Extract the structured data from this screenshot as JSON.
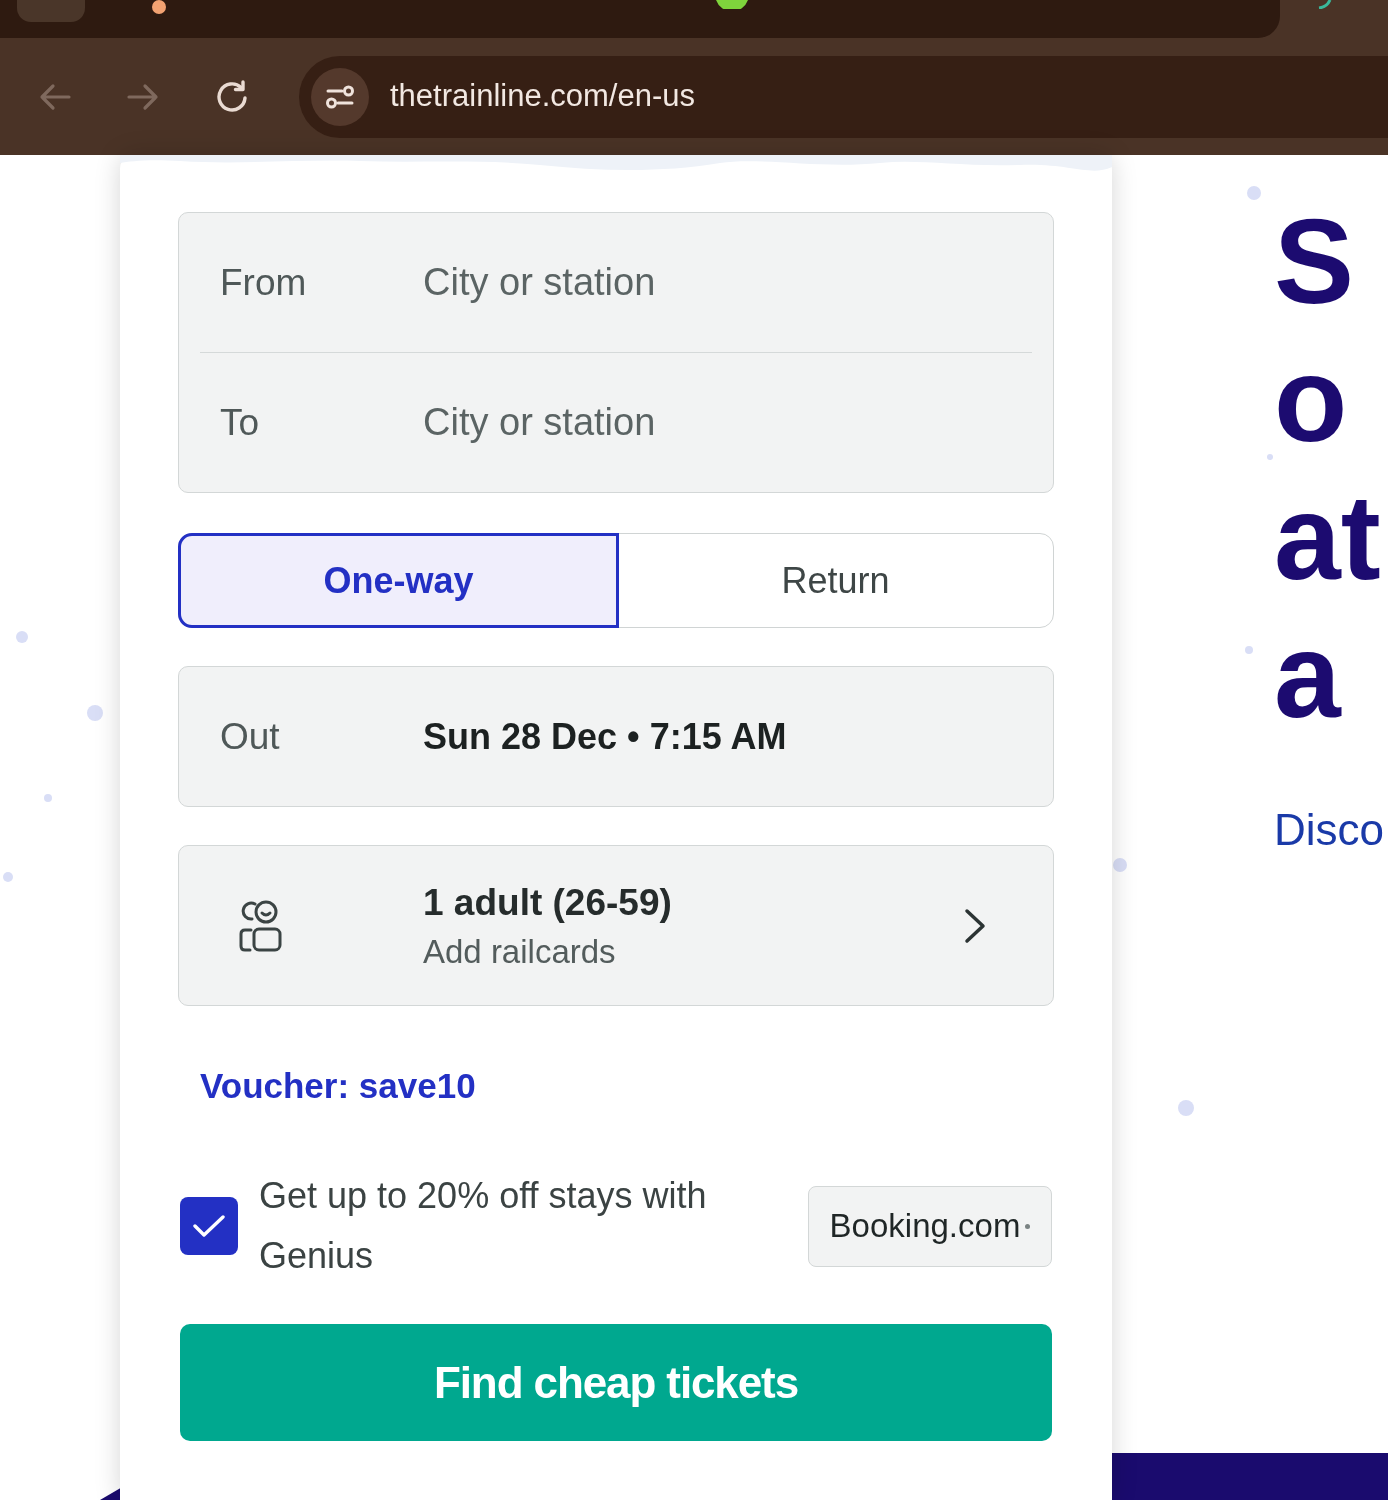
{
  "browser": {
    "nav_buttons": [
      {
        "kind": "back",
        "disabled": true
      },
      {
        "kind": "forward",
        "disabled": true
      },
      {
        "kind": "reload",
        "disabled": false
      }
    ],
    "url": "thetrainline.com/en-us"
  },
  "search_form": {
    "stations": [
      {
        "label": "From",
        "placeholder": "City or station"
      },
      {
        "label": "To",
        "placeholder": "City or station"
      }
    ],
    "trip_types": [
      {
        "label": "One-way",
        "selected": true
      },
      {
        "label": "Return",
        "selected": false
      }
    ],
    "departure": {
      "label": "Out",
      "value": "Sun 28 Dec • 7:15 AM"
    },
    "passengers": {
      "summary": "1 adult (26-59)",
      "hint": "Add railcards"
    },
    "voucher": "Voucher: save10",
    "hotel_offer": {
      "checked": true,
      "text": "Get up to 20% off stays with Genius",
      "partner": "Booking.com"
    },
    "submit": "Find cheap tickets"
  },
  "hero": {
    "headline_lines": [
      "S",
      "o",
      "at",
      "a"
    ],
    "link": "Disco"
  }
}
